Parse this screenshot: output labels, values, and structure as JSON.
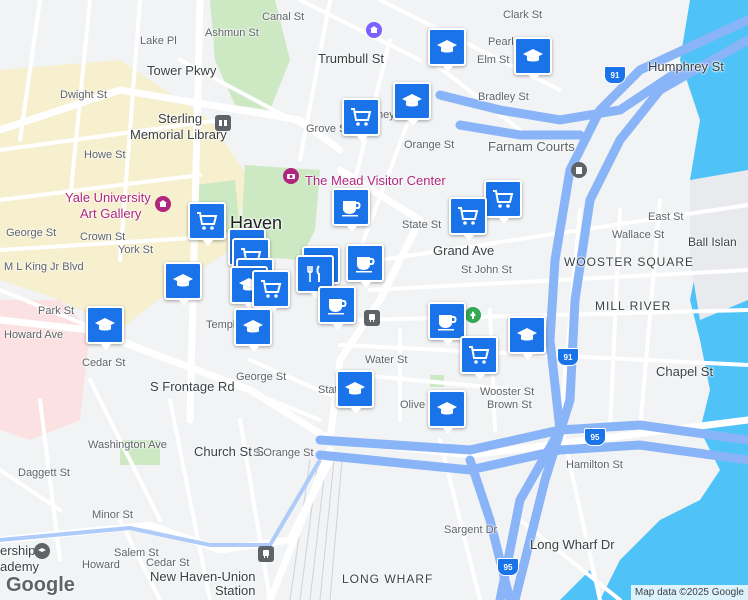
{
  "map": {
    "attribution": "Map data ©2025 Google",
    "logo": "Google",
    "colors": {
      "road": "#ffffff",
      "highway": "#8ab4f8",
      "water": "#4fc3f7",
      "park": "#cde9c4",
      "campus": "#f8efc6",
      "hospital": "#fbe1e1",
      "marker": "#1a73e8"
    }
  },
  "labels": {
    "streets": [
      "Clark St",
      "Pearl St",
      "Elm St",
      "Bradley St",
      "Humphrey St",
      "Trumbull St",
      "Canal St",
      "Ashmun St",
      "Lake Pl",
      "Tower Pkwy",
      "Dwight St",
      "Howe St",
      "Grove St",
      "Orange St",
      "Whitney Ave",
      "State St",
      "Crown St",
      "York St",
      "George St",
      "M L King Jr Blvd",
      "Howard Ave",
      "Park St",
      "Cedar St",
      "Temple St",
      "Grand Ave",
      "St John St",
      "Wallace St",
      "East St",
      "Chapel St",
      "Wooster St",
      "Olive St",
      "Brown St",
      "Hamilton St",
      "S Frontage Rd",
      "Washington Ave",
      "Church St S",
      "S Orange St",
      "Daggett St",
      "Minor St",
      "Salem St",
      "Sargent Dr",
      "Long Wharf Dr",
      "Water St"
    ],
    "places": [
      "Sterling Memorial Library",
      "The Mead Visitor Center",
      "Yale University Art Gallery",
      "Farnam Courts",
      "New Haven-Union Station",
      "Haven"
    ],
    "areas": [
      "WOOSTER SQUARE",
      "MILL RIVER",
      "LONG WHARF",
      "Ball Island"
    ],
    "highways": [
      "91",
      "95"
    ],
    "fragments": {
      "library_top": "Sterling",
      "library_bottom": "Memorial Library",
      "gallery_top": "Yale University",
      "gallery_bottom": "Art Gallery",
      "union_top": "New Haven-Union",
      "union_bottom": "Station",
      "partial_left1": "ership",
      "partial_left2": "ademy",
      "howard_cut": "Howard",
      "ball": "Ball Islan"
    }
  },
  "markers": [
    {
      "type": "school-icon"
    },
    {
      "type": "school-icon"
    },
    {
      "type": "school-icon"
    },
    {
      "type": "shopping-cart-icon"
    },
    {
      "type": "coffee-icon"
    },
    {
      "type": "shopping-cart-icon"
    },
    {
      "type": "shopping-cart-icon"
    },
    {
      "type": "shopping-cart-icon"
    },
    {
      "type": "shopping-cart-icon"
    },
    {
      "type": "shopping-cart-icon"
    },
    {
      "type": "shopping-cart-icon"
    },
    {
      "type": "school-icon"
    },
    {
      "type": "school-icon"
    },
    {
      "type": "coffee-icon"
    },
    {
      "type": "restaurant-icon"
    },
    {
      "type": "coffee-icon"
    },
    {
      "type": "shopping-cart-icon"
    },
    {
      "type": "coffee-icon"
    },
    {
      "type": "school-icon"
    },
    {
      "type": "coffee-icon"
    },
    {
      "type": "shopping-cart-icon"
    },
    {
      "type": "school-icon"
    },
    {
      "type": "school-icon"
    },
    {
      "type": "school-icon"
    },
    {
      "type": "school-icon"
    }
  ]
}
